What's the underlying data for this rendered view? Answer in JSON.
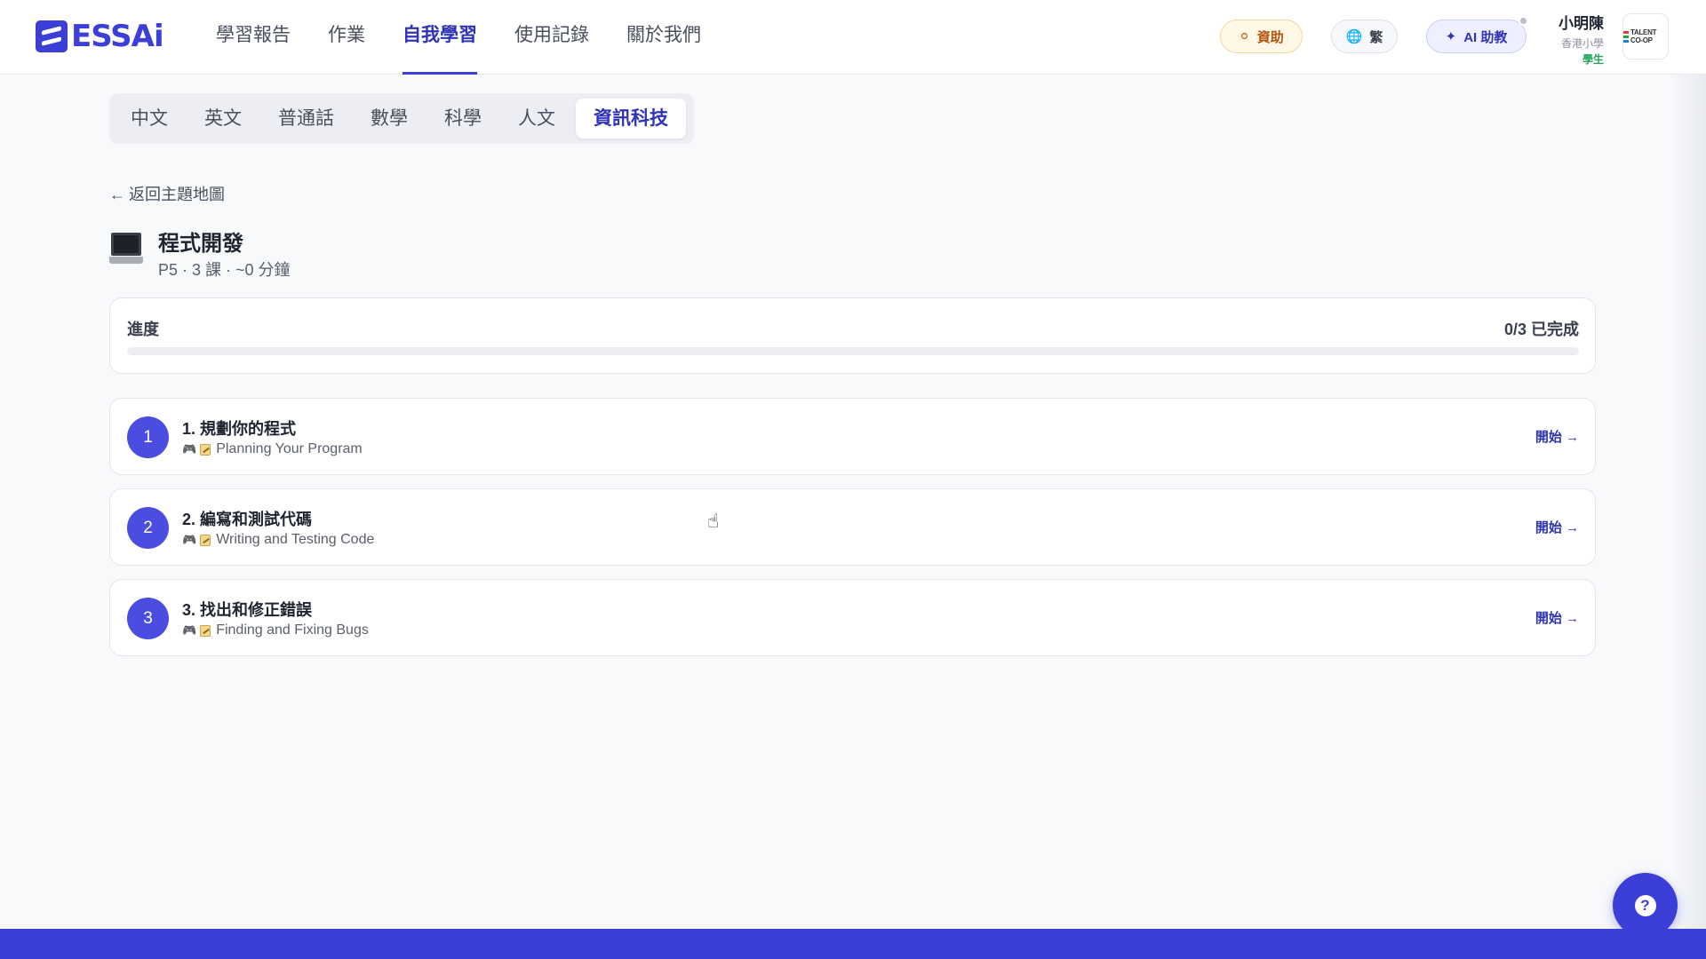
{
  "header": {
    "logo_text": "ESSAi",
    "nav": [
      {
        "label": "學習報告",
        "active": false
      },
      {
        "label": "作業",
        "active": false
      },
      {
        "label": "自我學習",
        "active": true
      },
      {
        "label": "使用記錄",
        "active": false
      },
      {
        "label": "關於我們",
        "active": false
      }
    ],
    "sponsor_label": "資助",
    "lang_label": "繁",
    "ai_label": "AI 助教",
    "user": {
      "name": "小明陳",
      "school": "香港小學",
      "role": "學生"
    },
    "org_logo_text": "TALENT CO-OP"
  },
  "subject_tabs": [
    {
      "label": "中文",
      "active": false
    },
    {
      "label": "英文",
      "active": false
    },
    {
      "label": "普通話",
      "active": false
    },
    {
      "label": "數學",
      "active": false
    },
    {
      "label": "科學",
      "active": false
    },
    {
      "label": "人文",
      "active": false
    },
    {
      "label": "資訊科技",
      "active": true
    }
  ],
  "back_label": "返回主題地圖",
  "topic": {
    "icon": "laptop-icon",
    "title": "程式開發",
    "meta": "P5 · 3 課 · ~0 分鐘"
  },
  "progress": {
    "label": "進度",
    "count_text": "0/3 已完成",
    "fraction": 0
  },
  "lessons": [
    {
      "number": "1",
      "title": "1. 規劃你的程式",
      "subtitle": "Planning Your Program",
      "start_label": "開始 →"
    },
    {
      "number": "2",
      "title": "2. 編寫和測試代碼",
      "subtitle": "Writing and Testing Code",
      "start_label": "開始 →"
    },
    {
      "number": "3",
      "title": "3. 找出和修正錯誤",
      "subtitle": "Finding and Fixing Bugs",
      "start_label": "開始 →"
    }
  ],
  "colors": {
    "accent": "#3b3fd8",
    "accent_text": "#2f33b5",
    "background": "#f8f9fb"
  }
}
